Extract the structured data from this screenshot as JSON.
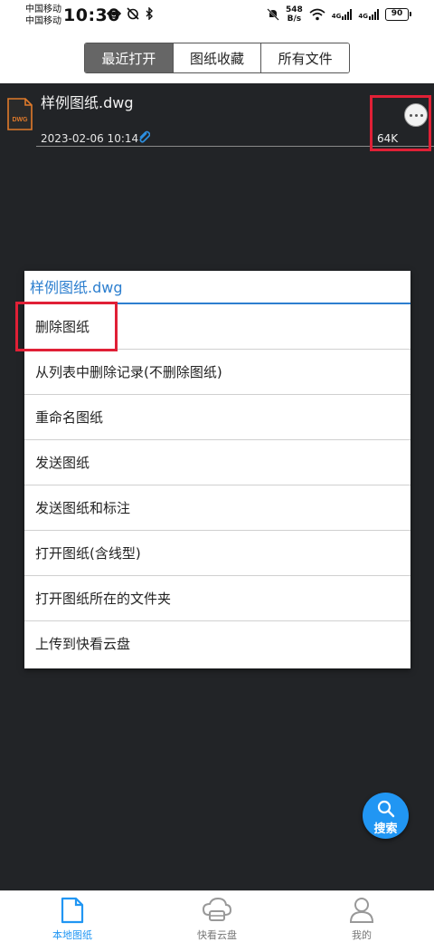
{
  "status_bar": {
    "carrier1": "中国移动",
    "carrier2": "中国移动",
    "time": "10:30",
    "net_speed_value": "548",
    "net_speed_unit": "B/s",
    "sig1_label": "4G",
    "sig2_label": "4G",
    "battery": "90"
  },
  "tabs": [
    {
      "label": "最近打开",
      "active": true
    },
    {
      "label": "图纸收藏",
      "active": false
    },
    {
      "label": "所有文件",
      "active": false
    }
  ],
  "file": {
    "icon_label": "DWG",
    "name": "样例图纸.dwg",
    "date": "2023-02-06 10:14",
    "size": "64K"
  },
  "dialog": {
    "title": "样例图纸.dwg",
    "items": [
      "删除图纸",
      "从列表中删除记录(不删除图纸)",
      "重命名图纸",
      "发送图纸",
      "发送图纸和标注",
      "打开图纸(含线型)",
      "打开图纸所在的文件夹",
      "上传到快看云盘"
    ]
  },
  "search_fab": {
    "label": "搜索"
  },
  "bottom_nav": [
    {
      "label": "本地图纸",
      "icon": "file-icon",
      "active": true
    },
    {
      "label": "快看云盘",
      "icon": "cloud-drive-icon",
      "active": false
    },
    {
      "label": "我的",
      "icon": "user-icon",
      "active": false
    }
  ],
  "colors": {
    "accent": "#2196f3",
    "highlight": "#e02036",
    "background": "#222427",
    "dwg_icon": "#e07a2a"
  }
}
